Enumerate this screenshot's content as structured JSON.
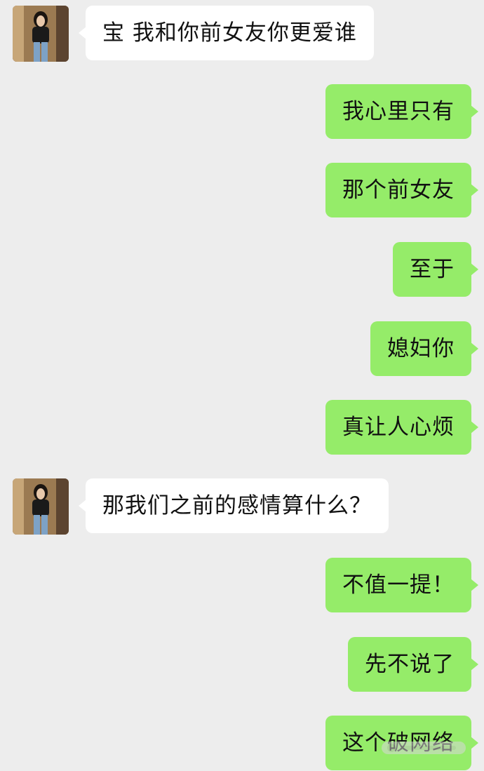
{
  "conversation": {
    "messages": [
      {
        "side": "left",
        "text": "宝 我和你前女友你更爱谁"
      },
      {
        "side": "right",
        "text": "我心里只有"
      },
      {
        "side": "right",
        "text": "那个前女友"
      },
      {
        "side": "right",
        "text": "至于"
      },
      {
        "side": "right",
        "text": "媳妇你"
      },
      {
        "side": "right",
        "text": "真让人心烦"
      },
      {
        "side": "left",
        "text": "那我们之前的感情算什么？"
      },
      {
        "side": "right",
        "text": "不值一提！"
      },
      {
        "side": "right",
        "text": "先不说了"
      },
      {
        "side": "right",
        "text": "这个破网络"
      }
    ]
  },
  "colors": {
    "background": "#ededed",
    "incoming_bubble": "#ffffff",
    "outgoing_bubble": "#95ec69",
    "text": "#111111"
  },
  "icons": {
    "contact_avatar": "girl-photo-avatar"
  }
}
